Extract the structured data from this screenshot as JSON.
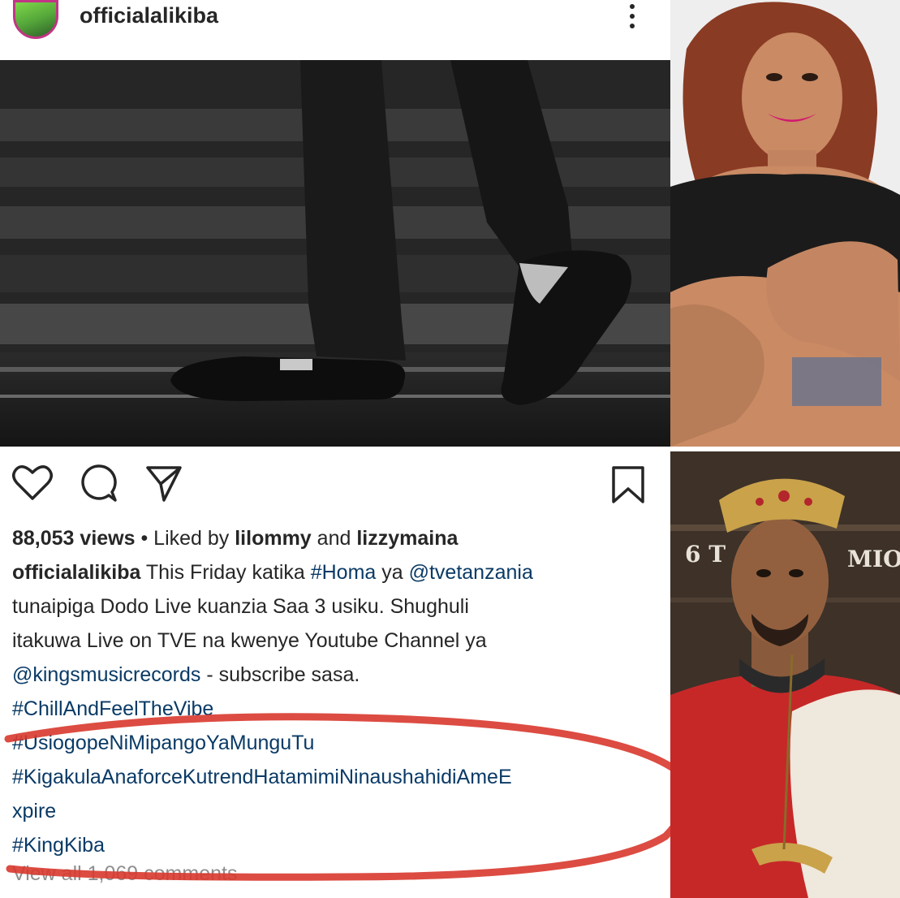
{
  "header": {
    "username": "officialalikiba",
    "avatar_icon": "avatar",
    "more_icon": "more-vertical-icon"
  },
  "actions": {
    "like_icon": "heart-icon",
    "comment_icon": "comment-icon",
    "share_icon": "send-icon",
    "save_icon": "bookmark-icon"
  },
  "stats": {
    "views": "88,053 views",
    "separator": " • ",
    "liked_by_prefix": "Liked by ",
    "liked_user_1": "lilommy",
    "and": " and ",
    "liked_user_2": "lizzymaina"
  },
  "caption": {
    "author": "officialalikiba",
    "t1": " This Friday katika ",
    "tag_homa": "#Homa",
    "t2": " ya ",
    "mention_tve": "@tvetanzania",
    "line2": "tunaipiga Dodo Live kuanzia Saa 3 usiku.  Shughuli",
    "line3": "itakuwa Live on TVE na kwenye Youtube Channel ya",
    "mention_kings": "@kingsmusicrecords",
    "t3": " - subscribe sasa.",
    "tag1": "#ChillAndFeelTheVibe",
    "tag2": "#UsiogopeNiMipangoYaMunguTu",
    "tag3a": "#KigakulaAnaforceKutrendHatamimiNinaushahidiAmeE",
    "tag3b": "xpire",
    "tag4": "#KingKiba",
    "view_comments": "View all 1,069 comments"
  },
  "side_photos": {
    "bottom_wall_left": "6 T",
    "bottom_wall_right": "MIO"
  },
  "colors": {
    "hashtag": "#0a3a66",
    "text": "#262626",
    "muted": "#8e8e8e",
    "annotation": "#d8382e"
  }
}
